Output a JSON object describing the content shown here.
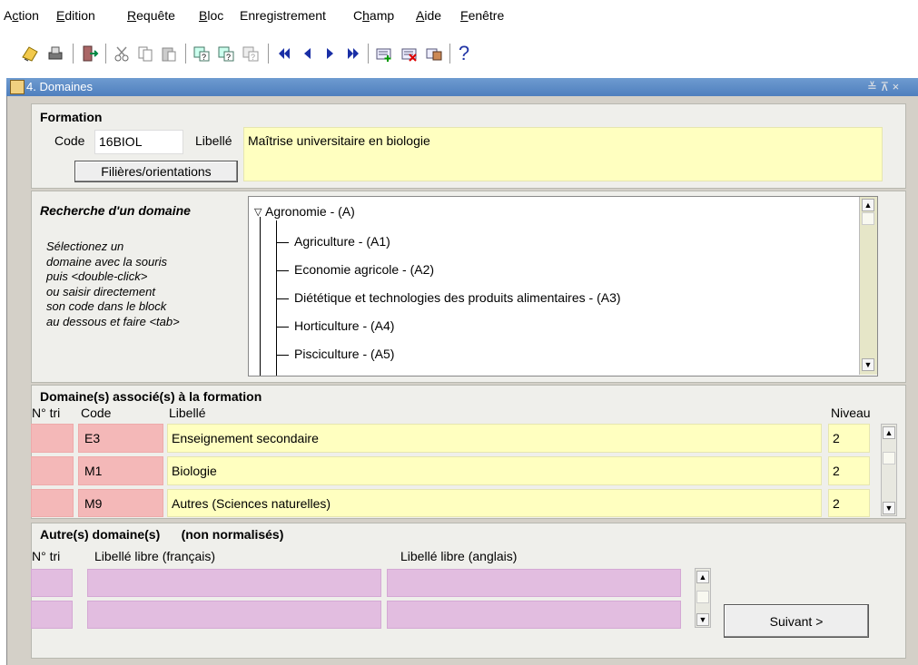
{
  "menu": [
    {
      "pre": "A",
      "u": "c",
      "post": "tion"
    },
    {
      "pre": "",
      "u": "E",
      "post": "dition"
    },
    {
      "pre": "",
      "u": "R",
      "post": "equête"
    },
    {
      "pre": "",
      "u": "B",
      "post": "loc"
    },
    {
      "pre": "",
      "u": "",
      "post": "Enregistrement"
    },
    {
      "pre": "C",
      "u": "h",
      "post": "amp"
    },
    {
      "pre": "",
      "u": "A",
      "post": "ide"
    },
    {
      "pre": "",
      "u": "F",
      "post": "enêtre"
    }
  ],
  "toolbar": {
    "icons": [
      "save-icon",
      "print-icon",
      "exit-icon",
      "cut-icon",
      "copy-icon",
      "paste-icon",
      "enter-query-icon",
      "execute-query-icon",
      "cancel-query-icon",
      "first-record-icon",
      "previous-record-icon",
      "next-record-icon",
      "last-record-icon",
      "insert-record-icon",
      "delete-record-icon",
      "lock-record-icon",
      "help-icon"
    ],
    "help_glyph": "?"
  },
  "window": {
    "title": "4. Domaines",
    "controls": "≚ ⊼ ×"
  },
  "formation": {
    "heading": "Formation",
    "code_label": "Code",
    "code_value": "16BIOL",
    "libelle_label": "Libellé",
    "libelle_value": "Maîtrise universitaire en biologie",
    "filieres_button": "Filières/orientations"
  },
  "recherche": {
    "heading": "Recherche d'un domaine",
    "instructions": [
      "Sélectionez un",
      "domaine avec la souris",
      "puis <double-click>",
      "ou saisir directement",
      "son code dans le block",
      "au dessous et faire <tab>"
    ],
    "tree_root": "Agronomie -  (A)",
    "tree_items": [
      "Agriculture -  (A1)",
      "Economie agricole -  (A2)",
      "Diététique et technologies des produits alimentaires -  (A3)",
      "Horticulture -  (A4)",
      "Pisciculture -  (A5)"
    ]
  },
  "domaines": {
    "heading": "Domaine(s) associé(s)  à la formation",
    "col_tri": "N° tri",
    "col_code": "Code",
    "col_libelle": "Libellé",
    "col_niveau": "Niveau",
    "rows": [
      {
        "tri": "",
        "code": "E3",
        "libelle": "Enseignement secondaire",
        "niveau": "2"
      },
      {
        "tri": "",
        "code": "M1",
        "libelle": "Biologie",
        "niveau": "2"
      },
      {
        "tri": "",
        "code": "M9",
        "libelle": "Autres (Sciences naturelles)",
        "niveau": "2"
      }
    ]
  },
  "autres": {
    "heading": "Autre(s) domaine(s)      (non normalisés)",
    "col_tri": "N° tri",
    "col_fr": "Libellé libre (français)",
    "col_en": "Libellé libre (anglais)",
    "suivant_button": "Suivant >"
  }
}
